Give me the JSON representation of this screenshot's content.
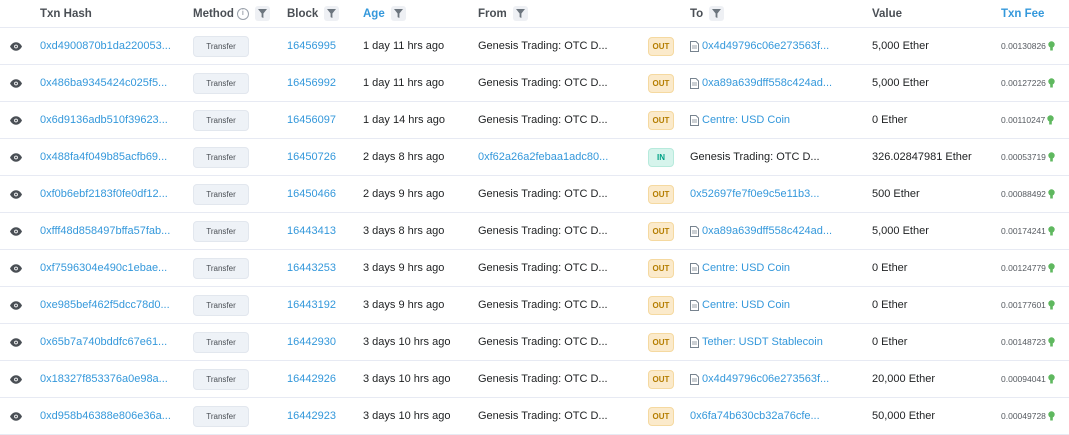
{
  "headers": {
    "txn_hash": "Txn Hash",
    "method": "Method",
    "block": "Block",
    "age": "Age",
    "from": "From",
    "to": "To",
    "value": "Value",
    "txn_fee": "Txn Fee"
  },
  "colors": {
    "link": "#3498db",
    "out_badge": "#fbeacb",
    "in_badge": "#d6f4ec",
    "fee_bulb": "#5fb85f"
  },
  "rows": [
    {
      "hash": "0xd4900870b1da220053...",
      "method": "Transfer",
      "block": "16456995",
      "age": "1 day 11 hrs ago",
      "from": "Genesis Trading: OTC D...",
      "from_link": false,
      "dir": "OUT",
      "to": "0x4d49796c06e273563f...",
      "to_link": true,
      "to_contract": true,
      "value": "5,000 Ether",
      "fee": "0.00130826"
    },
    {
      "hash": "0x486ba9345424c025f5...",
      "method": "Transfer",
      "block": "16456992",
      "age": "1 day 11 hrs ago",
      "from": "Genesis Trading: OTC D...",
      "from_link": false,
      "dir": "OUT",
      "to": "0xa89a639dff558c424ad...",
      "to_link": true,
      "to_contract": true,
      "value": "5,000 Ether",
      "fee": "0.00127226"
    },
    {
      "hash": "0x6d9136adb510f39623...",
      "method": "Transfer",
      "block": "16456097",
      "age": "1 day 14 hrs ago",
      "from": "Genesis Trading: OTC D...",
      "from_link": false,
      "dir": "OUT",
      "to": "Centre: USD Coin",
      "to_link": true,
      "to_contract": true,
      "value": "0 Ether",
      "fee": "0.00110247"
    },
    {
      "hash": "0x488fa4f049b85acfb69...",
      "method": "Transfer",
      "block": "16450726",
      "age": "2 days 8 hrs ago",
      "from": "0xf62a26a2febaa1adc80...",
      "from_link": true,
      "dir": "IN",
      "to": "Genesis Trading: OTC D...",
      "to_link": false,
      "to_contract": false,
      "value": "326.02847981 Ether",
      "fee": "0.00053719"
    },
    {
      "hash": "0xf0b6ebf2183f0fe0df12...",
      "method": "Transfer",
      "block": "16450466",
      "age": "2 days 9 hrs ago",
      "from": "Genesis Trading: OTC D...",
      "from_link": false,
      "dir": "OUT",
      "to": "0x52697fe7f0e9c5e11b3...",
      "to_link": true,
      "to_contract": false,
      "value": "500 Ether",
      "fee": "0.00088492"
    },
    {
      "hash": "0xfff48d858497bffa57fab...",
      "method": "Transfer",
      "block": "16443413",
      "age": "3 days 8 hrs ago",
      "from": "Genesis Trading: OTC D...",
      "from_link": false,
      "dir": "OUT",
      "to": "0xa89a639dff558c424ad...",
      "to_link": true,
      "to_contract": true,
      "value": "5,000 Ether",
      "fee": "0.00174241"
    },
    {
      "hash": "0xf7596304e490c1ebae...",
      "method": "Transfer",
      "block": "16443253",
      "age": "3 days 9 hrs ago",
      "from": "Genesis Trading: OTC D...",
      "from_link": false,
      "dir": "OUT",
      "to": "Centre: USD Coin",
      "to_link": true,
      "to_contract": true,
      "value": "0 Ether",
      "fee": "0.00124779"
    },
    {
      "hash": "0xe985bef462f5dcc78d0...",
      "method": "Transfer",
      "block": "16443192",
      "age": "3 days 9 hrs ago",
      "from": "Genesis Trading: OTC D...",
      "from_link": false,
      "dir": "OUT",
      "to": "Centre: USD Coin",
      "to_link": true,
      "to_contract": true,
      "value": "0 Ether",
      "fee": "0.00177601"
    },
    {
      "hash": "0x65b7a740bddfc67e61...",
      "method": "Transfer",
      "block": "16442930",
      "age": "3 days 10 hrs ago",
      "from": "Genesis Trading: OTC D...",
      "from_link": false,
      "dir": "OUT",
      "to": "Tether: USDT Stablecoin",
      "to_link": true,
      "to_contract": true,
      "value": "0 Ether",
      "fee": "0.00148723"
    },
    {
      "hash": "0x18327f853376a0e98a...",
      "method": "Transfer",
      "block": "16442926",
      "age": "3 days 10 hrs ago",
      "from": "Genesis Trading: OTC D...",
      "from_link": false,
      "dir": "OUT",
      "to": "0x4d49796c06e273563f...",
      "to_link": true,
      "to_contract": true,
      "value": "20,000 Ether",
      "fee": "0.00094041"
    },
    {
      "hash": "0xd958b46388e806e36a...",
      "method": "Transfer",
      "block": "16442923",
      "age": "3 days 10 hrs ago",
      "from": "Genesis Trading: OTC D...",
      "from_link": false,
      "dir": "OUT",
      "to": "0x6fa74b630cb32a76cfe...",
      "to_link": true,
      "to_contract": false,
      "value": "50,000 Ether",
      "fee": "0.00049728"
    }
  ]
}
